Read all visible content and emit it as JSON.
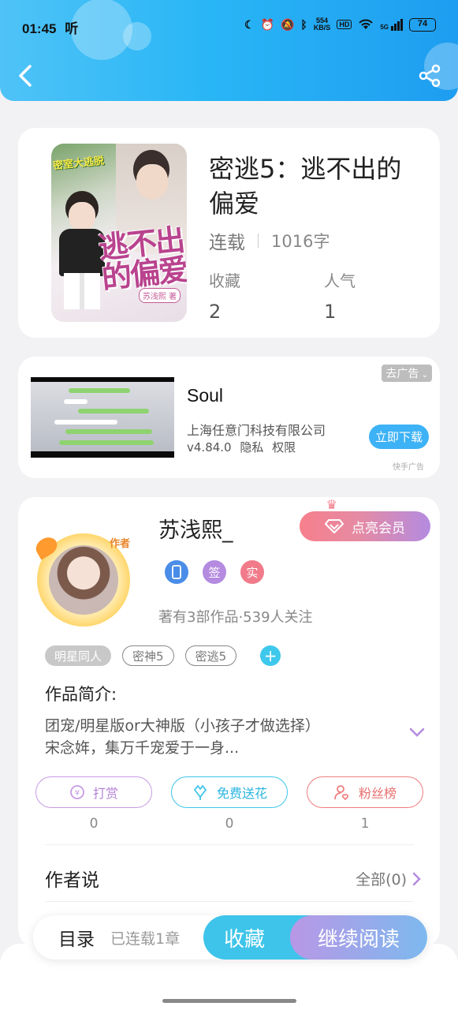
{
  "status_bar": {
    "time": "01:45",
    "carrier_glyph": "听",
    "net_speed_value": "554",
    "net_speed_unit": "KB/S",
    "hd_label": "HD",
    "signal_label": "5G",
    "battery_level": "74"
  },
  "book": {
    "title": "密逃5：逃不出的偏爱",
    "status": "连载",
    "word_count": "1016字",
    "cover": {
      "top_text": "密室大逃脱",
      "title_text": "逃不出的偏爱",
      "author_stamp": "苏浅熙 著"
    },
    "stats": [
      {
        "label": "收藏",
        "value": "2"
      },
      {
        "label": "人气",
        "value": "1"
      }
    ]
  },
  "ad": {
    "close_label": "去广告",
    "app_name": "Soul",
    "company": "上海任意门科技有限公司",
    "version": "v4.84.0",
    "privacy_label": "隐私",
    "permissions_label": "权限",
    "download_label": "立即下载",
    "source_label": "快手广告"
  },
  "author": {
    "name": "苏浅熙_",
    "avatar_tag": "作者",
    "vip_label": "点亮会员",
    "badges": [
      {
        "icon": "phone-icon",
        "label": "",
        "color": "#4a8de8"
      },
      {
        "icon": "sign-icon",
        "label": "签",
        "color": "#b48be0"
      },
      {
        "icon": "verified-icon",
        "label": "实",
        "color": "#f17b8a"
      }
    ],
    "stats_text": "著有3部作品·539人关注"
  },
  "tags": [
    {
      "label": "明星同人",
      "style": "filled"
    },
    {
      "label": "密神5",
      "style": "outline"
    },
    {
      "label": "密逃5",
      "style": "outline"
    }
  ],
  "intro": {
    "label": "作品简介:",
    "text_line1": "团宠/明星版or大神版（小孩子才做选择）",
    "text_line2": "宋念姩，集万千宠爱于一身..."
  },
  "actions": [
    {
      "label": "打赏",
      "count": "0",
      "color": "#c79be3"
    },
    {
      "label": "免费送花",
      "count": "0",
      "color": "#3ec4ea"
    },
    {
      "label": "粉丝榜",
      "count": "1",
      "color": "#f07d7d"
    }
  ],
  "author_says": {
    "label": "作者说",
    "all_label": "全部(0)"
  },
  "bottom_bar": {
    "toc_label": "目录",
    "toc_sub": "已连载1章",
    "collect_label": "收藏",
    "read_label": "继续阅读"
  },
  "colors": {
    "header_gradient_start": "#4fc3f7",
    "header_gradient_end": "#1e9df0",
    "vip_gradient_start": "#f77f8c",
    "vip_gradient_end": "#b48be0",
    "accent_cyan": "#3ec4ea"
  }
}
